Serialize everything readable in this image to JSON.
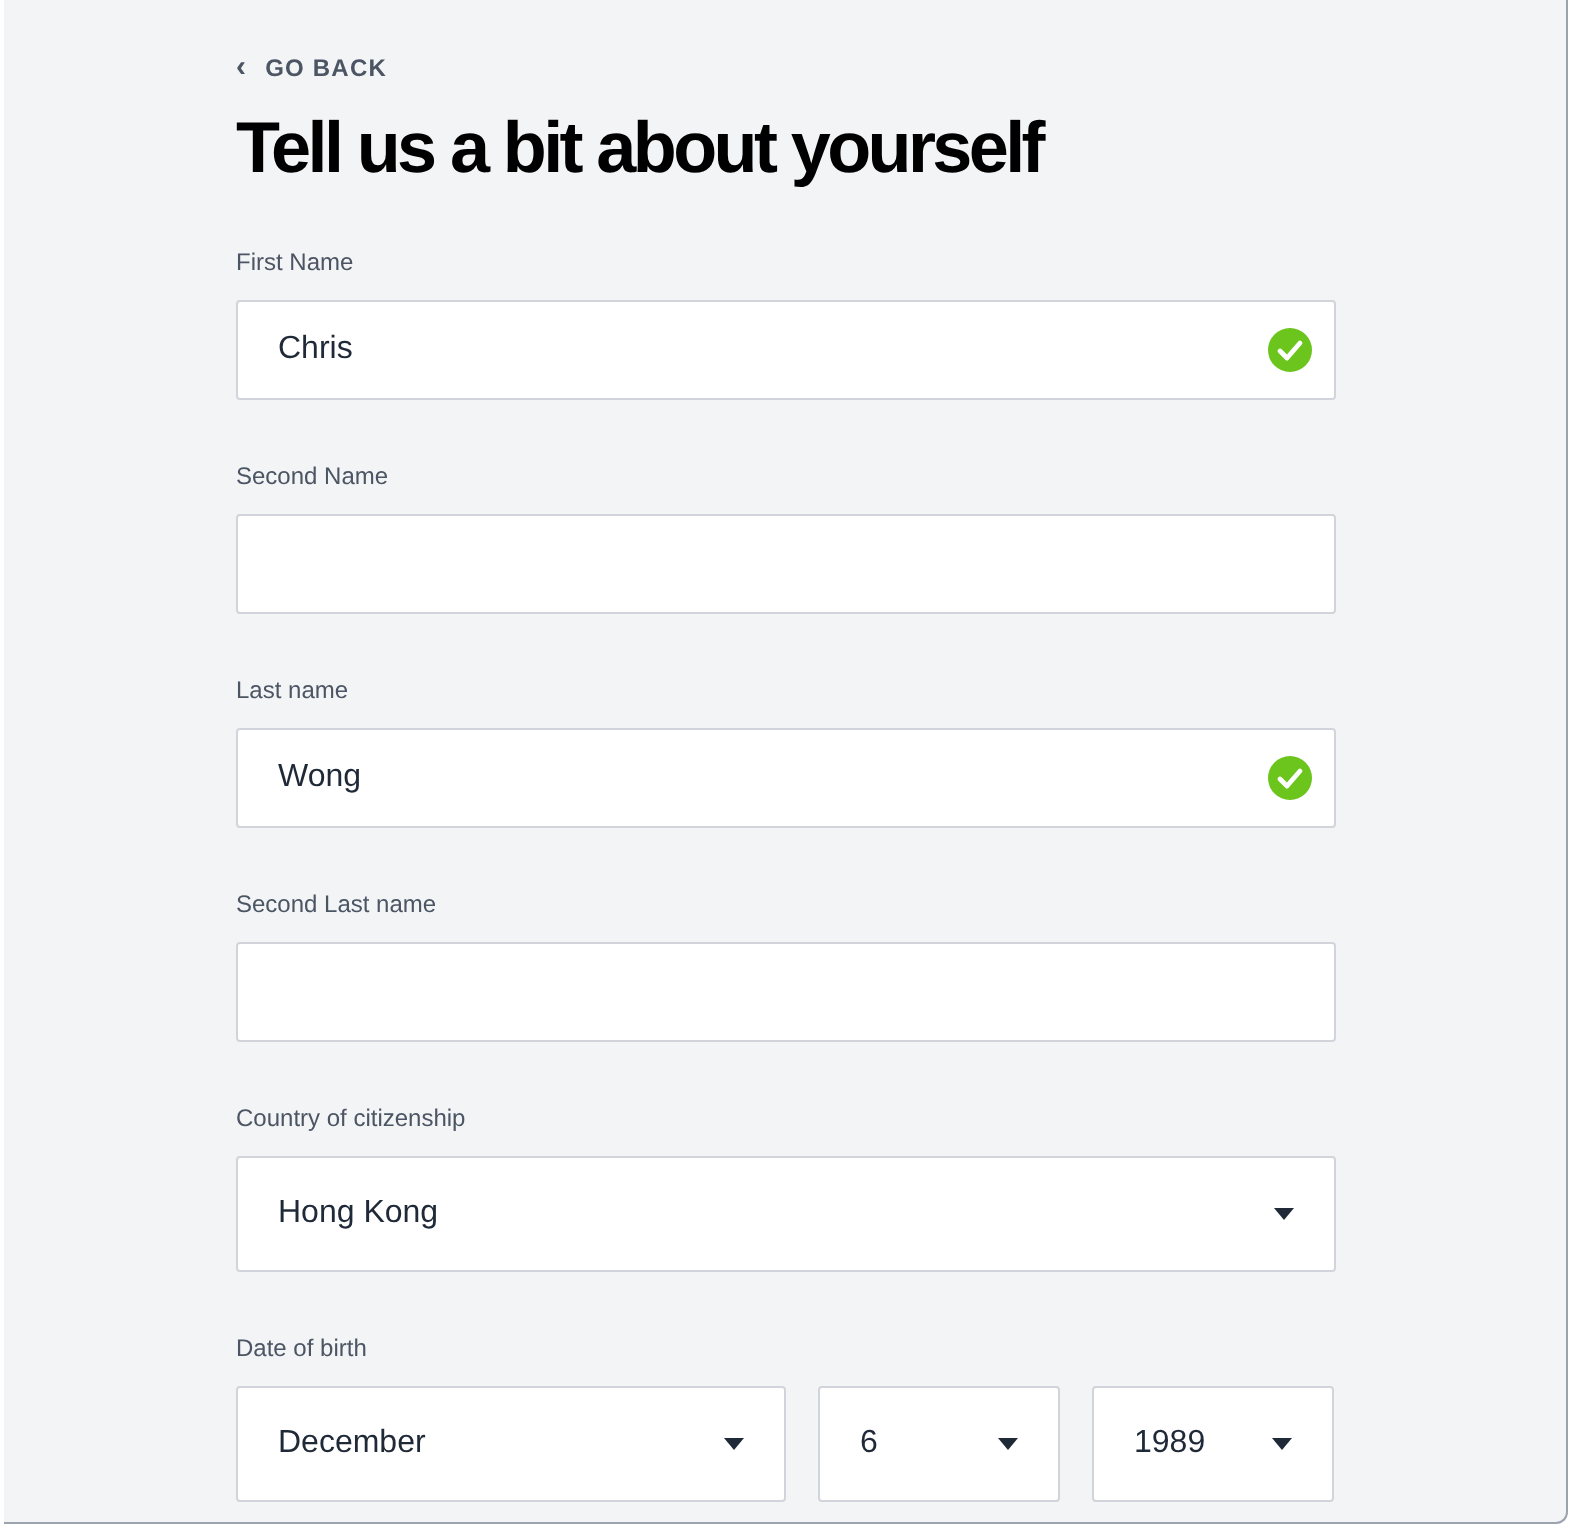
{
  "back_link": {
    "icon": "‹",
    "label": "GO BACK"
  },
  "title": "Tell us a bit about yourself",
  "fields": [
    {
      "kind": "text",
      "label": "First Name",
      "value": "Chris",
      "valid": true
    },
    {
      "kind": "text",
      "label": "Second Name",
      "valid": false
    },
    {
      "kind": "text",
      "label": "Last name",
      "value": "Wong",
      "valid": true
    },
    {
      "kind": "text",
      "label": "Second Last name",
      "valid": false
    },
    {
      "kind": "select",
      "label": "Country of citizenship",
      "value": "Hong Kong"
    }
  ],
  "date_of_birth": {
    "label": "Date of birth",
    "parts": [
      {
        "value": "December"
      },
      {
        "value": "6"
      },
      {
        "value": "1989"
      }
    ]
  }
}
